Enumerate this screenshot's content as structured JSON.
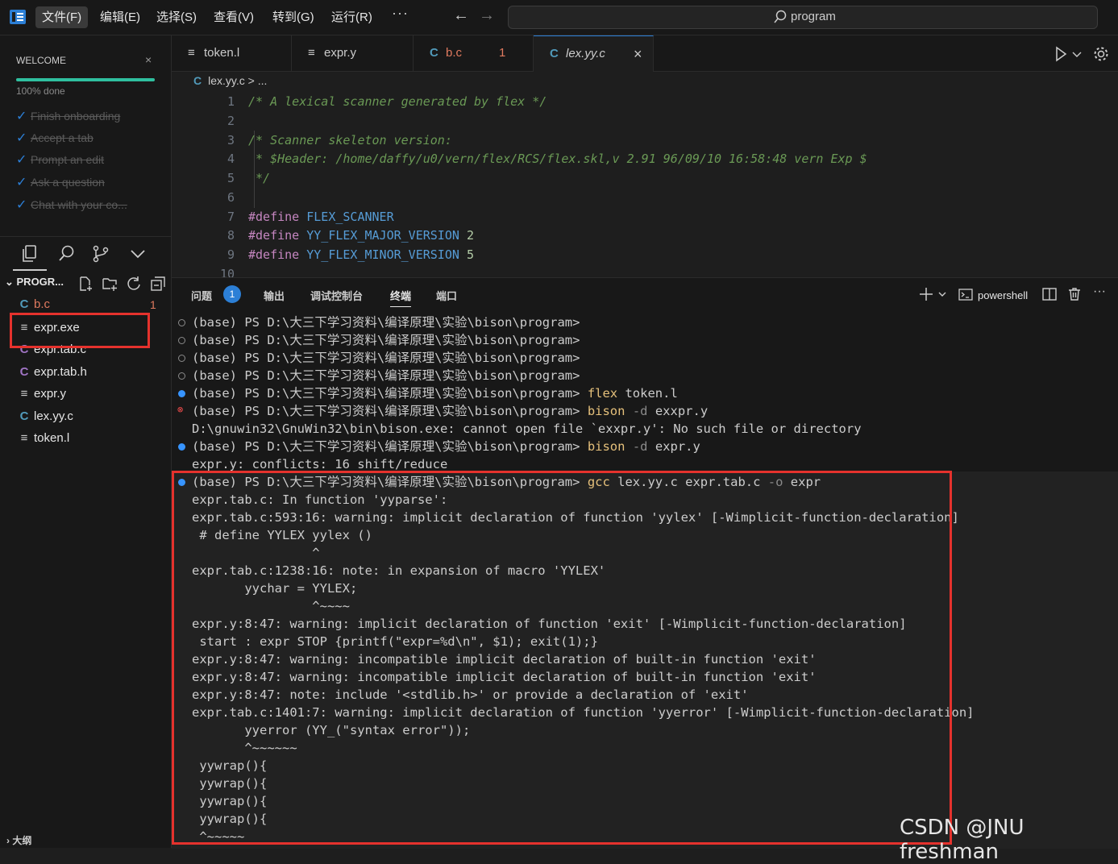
{
  "titlebar": {
    "menus": [
      "文件(F)",
      "编辑(E)",
      "选择(S)",
      "查看(V)",
      "转到(G)",
      "运行(R)"
    ],
    "more": "···",
    "search_text": "program"
  },
  "welcome": {
    "title": "WELCOME",
    "close": "×",
    "progress_fraction": 1.0,
    "progress_text": "100% done",
    "tasks": [
      "Finish onboarding",
      "Accept a tab",
      "Prompt an edit",
      "Ask a question",
      "Chat with your co..."
    ]
  },
  "explorer": {
    "title": "PROGR...",
    "files": [
      {
        "name": "b.c",
        "icon": "C",
        "badge": "1"
      },
      {
        "name": "expr.exe",
        "icon": "≡",
        "badge": ""
      },
      {
        "name": "expr.tab.c",
        "icon": "C",
        "badge": ""
      },
      {
        "name": "expr.tab.h",
        "icon": "C",
        "badge": ""
      },
      {
        "name": "expr.y",
        "icon": "≡",
        "badge": ""
      },
      {
        "name": "lex.yy.c",
        "icon": "C",
        "badge": ""
      },
      {
        "name": "token.l",
        "icon": "≡",
        "badge": ""
      }
    ],
    "outline": "大纲"
  },
  "tabs": [
    {
      "label": "token.l",
      "icon": "≡",
      "badge": ""
    },
    {
      "label": "expr.y",
      "icon": "≡",
      "badge": ""
    },
    {
      "label": "b.c",
      "icon": "C",
      "badge": "1"
    },
    {
      "label": "lex.yy.c",
      "icon": "C",
      "badge": ""
    }
  ],
  "tab_close": "×",
  "breadcrumb": {
    "icon": "C",
    "file": "lex.yy.c",
    "rest": " > ..."
  },
  "editor": {
    "line_numbers": [
      "1",
      "2",
      "3",
      "4",
      "5",
      "6",
      "7",
      "8",
      "9",
      "10"
    ],
    "lines": [
      "/* A lexical scanner generated by flex */",
      "",
      "/* Scanner skeleton version:",
      " * $Header: /home/daffy/u0/vern/flex/RCS/flex.skl,v 2.91 96/09/10 16:58:48 vern Exp $",
      " */",
      "",
      "",
      "",
      "",
      ""
    ],
    "defines": [
      {
        "kw": "#define",
        "name": "FLEX_SCANNER",
        "val": ""
      },
      {
        "kw": "#define",
        "name": "YY_FLEX_MAJOR_VERSION",
        "val": "2"
      },
      {
        "kw": "#define",
        "name": "YY_FLEX_MINOR_VERSION",
        "val": "5"
      }
    ]
  },
  "panel": {
    "tabs": [
      "问题",
      "输出",
      "调试控制台",
      "终端",
      "端口"
    ],
    "problem_count": "1",
    "shell": "powershell"
  },
  "terminal": {
    "prompt": "(base) PS D:\\大三下学习资料\\编译原理\\实验\\bison\\program>",
    "cmd_flex": "flex",
    "args_flex": " token.l",
    "cmd_bison": "bison",
    "flag_d": "-d",
    "args_bison1": " exxpr.y",
    "args_bison2": " expr.y",
    "err_bison": "D:\\gnuwin32\\GnuWin32\\bin\\bison.exe: cannot open file `exxpr.y': No such file or directory",
    "conflicts": "expr.y: conflicts: 16 shift/reduce",
    "cmd_gcc": "gcc",
    "args_gcc1": " lex.yy.c expr.tab.c ",
    "flag_o": "-o",
    "args_gcc2": " expr",
    "output": [
      "expr.tab.c: In function 'yyparse':",
      "expr.tab.c:593:16: warning: implicit declaration of function 'yylex' [-Wimplicit-function-declaration]",
      " # define YYLEX yylex ()",
      "                ^",
      "expr.tab.c:1238:16: note: in expansion of macro 'YYLEX'",
      "       yychar = YYLEX;",
      "                ^~~~~",
      "expr.y:8:47: warning: implicit declaration of function 'exit' [-Wimplicit-function-declaration]",
      " start : expr STOP {printf(\"expr=%d\\n\", $1); exit(1);}",
      "expr.y:8:47: warning: incompatible implicit declaration of built-in function 'exit'",
      "expr.y:8:47: warning: incompatible implicit declaration of built-in function 'exit'",
      "expr.y:8:47: note: include '<stdlib.h>' or provide a declaration of 'exit'",
      "expr.tab.c:1401:7: warning: implicit declaration of function 'yyerror' [-Wimplicit-function-declaration]",
      "       yyerror (YY_(\"syntax error\"));",
      "       ^~~~~~~",
      " yywrap(){",
      " yywrap(){",
      " yywrap(){",
      " yywrap(){",
      " ^~~~~~"
    ]
  },
  "watermark": "CSDN @JNU freshman",
  "colors": {
    "accent": "#2c7fd6",
    "progress": "#2fbf9f",
    "annotation_box": "#e5322d",
    "command": "#e5c07b"
  }
}
